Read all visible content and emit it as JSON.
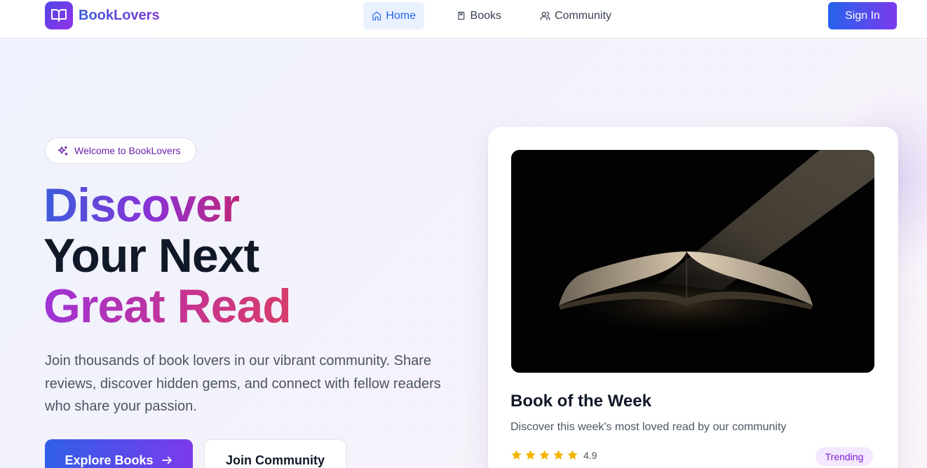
{
  "nav": {
    "brand": "BookLovers",
    "items": [
      {
        "label": "Home",
        "icon": "home-icon",
        "active": true
      },
      {
        "label": "Books",
        "icon": "book-icon",
        "active": false
      },
      {
        "label": "Community",
        "icon": "users-icon",
        "active": false
      }
    ],
    "signin_label": "Sign In"
  },
  "hero": {
    "badge": "Welcome to BookLovers",
    "headline": [
      "Discover",
      "Your Next",
      "Great Read"
    ],
    "description": "Join thousands of book lovers in our vibrant community. Share reviews, discover hidden gems, and connect with fellow readers who share your passion.",
    "primary_cta": "Explore Books",
    "secondary_cta": "Join Community"
  },
  "featured": {
    "title": "Book of the Week",
    "description": "Discover this week's most loved read by our community",
    "rating": "4.9",
    "stars": 5,
    "tag": "Trending"
  },
  "colors": {
    "brand_start": "#2563eb",
    "brand_end": "#7c3aed",
    "star": "#f5b400",
    "tag_bg": "#f3e8ff",
    "tag_text": "#7e22ce"
  }
}
